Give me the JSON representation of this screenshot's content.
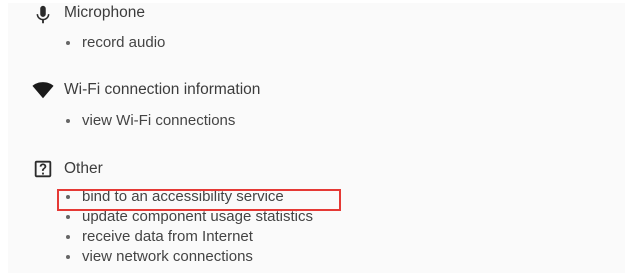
{
  "sections": [
    {
      "title": "Microphone",
      "icon": "microphone-icon",
      "permissions": [
        "record audio"
      ]
    },
    {
      "title": "Wi-Fi connection information",
      "icon": "wifi-icon",
      "permissions": [
        "view Wi-Fi connections"
      ]
    },
    {
      "title": "Other",
      "icon": "help-box-icon",
      "permissions": [
        "bind to an accessibility service",
        "update component usage statistics",
        "receive data from Internet",
        "view network connections"
      ]
    }
  ],
  "highlight": {
    "label": "bind to an accessibility service",
    "color": "#e53935"
  }
}
